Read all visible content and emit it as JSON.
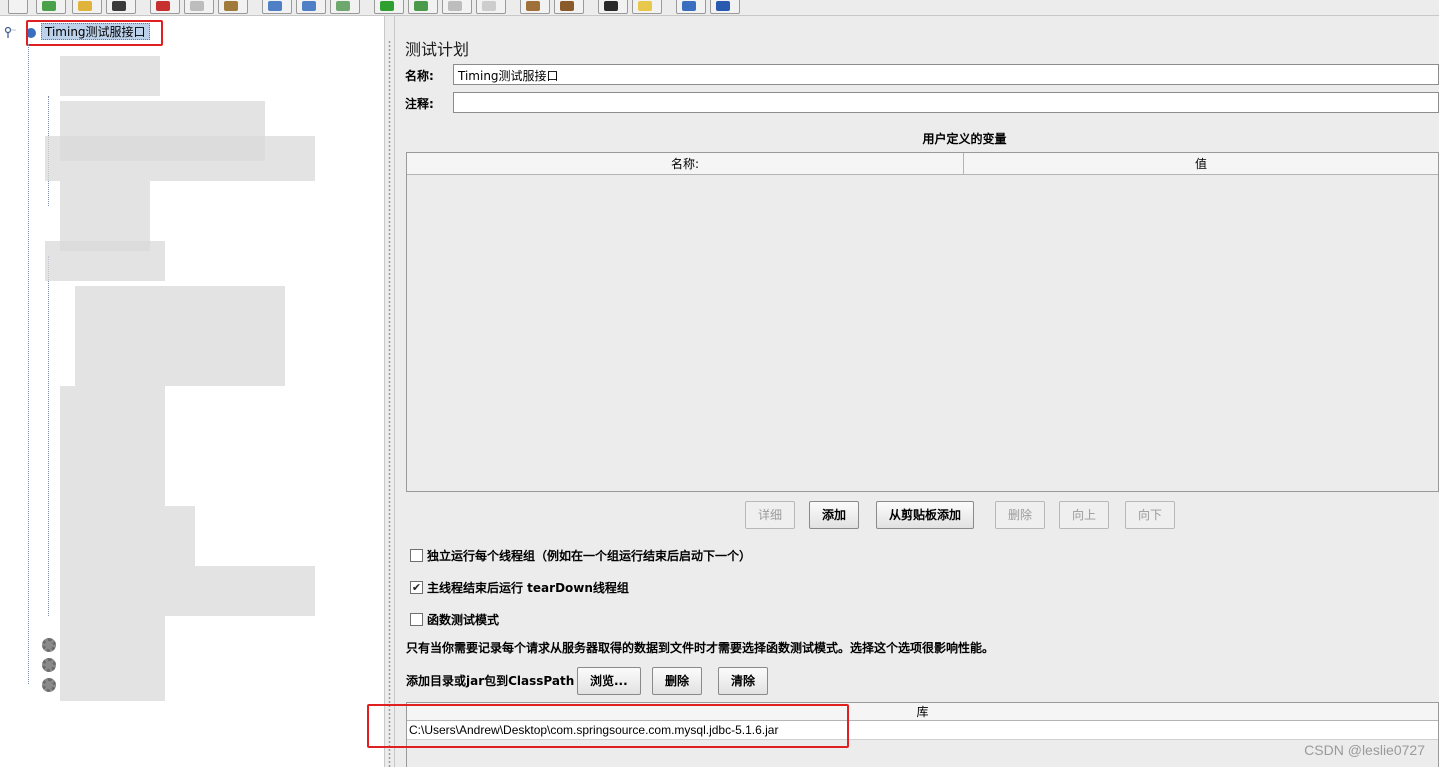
{
  "tree": {
    "root_label": "Timing测试服接口"
  },
  "panel": {
    "title": "测试计划",
    "name_label": "名称:",
    "name_value": "Timing测试服接口",
    "comment_label": "注释:",
    "comment_value": ""
  },
  "variables": {
    "title": "用户定义的变量",
    "columns": [
      "名称:",
      "值"
    ],
    "buttons": {
      "detail": "详细",
      "add": "添加",
      "add_from_clipboard": "从剪贴板添加",
      "delete": "删除",
      "up": "向上",
      "down": "向下"
    }
  },
  "options": {
    "serialize_thread_groups": {
      "label": "独立运行每个线程组（例如在一个组运行结束后启动下一个）",
      "checked": false
    },
    "teardown_on_shutdown": {
      "label": "主线程结束后运行 tearDown线程组",
      "checked": true
    },
    "functional_mode": {
      "label": "函数测试模式",
      "checked": false
    },
    "functional_mode_note": "只有当你需要记录每个请求从服务器取得的数据到文件时才需要选择函数测试模式。选择这个选项很影响性能。"
  },
  "classpath": {
    "label": "添加目录或jar包到ClassPath",
    "browse_button": "浏览...",
    "delete_button": "删除",
    "clear_button": "清除",
    "table_header": "库",
    "entries": [
      "C:\\Users\\Andrew\\Desktop\\com.springsource.com.mysql.jdbc-5.1.6.jar"
    ]
  },
  "checkmark": "✔",
  "watermark": "CSDN @leslie0727",
  "colors": {
    "highlight_box": "#e02020",
    "selected_node_bg": "#bcd1ea"
  }
}
